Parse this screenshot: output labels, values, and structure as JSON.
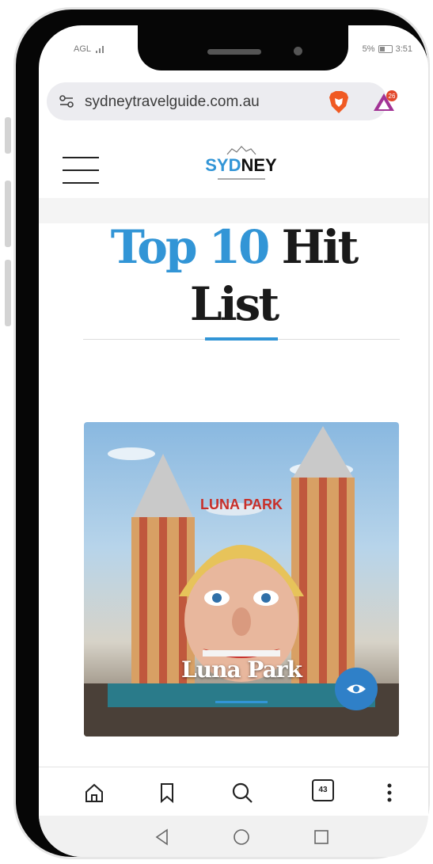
{
  "status_bar": {
    "carrier": "AGL",
    "battery_percent": "5%",
    "time": "3:51"
  },
  "address_bar": {
    "url": "sydneytravelguide.com.au",
    "reward_badge_count": "26"
  },
  "site_header": {
    "logo": {
      "part1": "SYD",
      "part2": "NEY"
    }
  },
  "page": {
    "heading": {
      "accent": "Top 10",
      "line1_rest": "Hit",
      "line2": "List"
    },
    "card": {
      "title": "Luna Park",
      "sign_text": "LUNA PARK"
    }
  },
  "toolbar": {
    "tab_count": "43"
  },
  "colors": {
    "accent": "#3295d6",
    "frame": "#060606",
    "fab": "#2f80c8"
  },
  "icons": [
    "home-icon",
    "bookmark-icon",
    "search-icon",
    "tabs-icon",
    "more-menu-icon",
    "back-icon",
    "nav-home-icon",
    "recents-icon",
    "site-settings-icon",
    "brave-shield-icon",
    "brave-rewards-icon",
    "hamburger-menu-icon",
    "eye-icon"
  ]
}
